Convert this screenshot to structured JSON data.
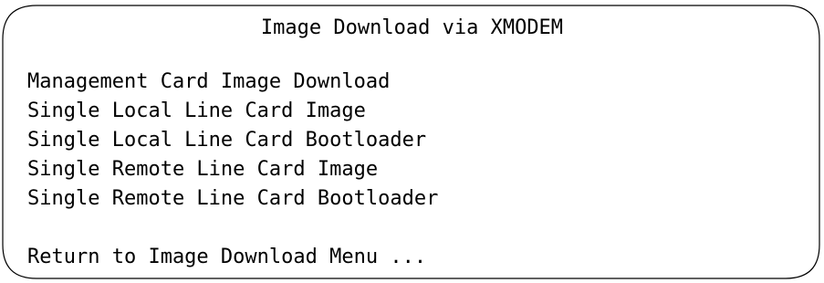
{
  "screen": {
    "title": "Image Download via XMODEM"
  },
  "menu": {
    "items": [
      {
        "label": "Management Card Image Download"
      },
      {
        "label": "Single Local Line Card Image"
      },
      {
        "label": "Single Local Line Card Bootloader"
      },
      {
        "label": "Single Remote Line Card Image"
      },
      {
        "label": "Single Remote Line Card Bootloader"
      }
    ],
    "return_label": "Return to Image Download Menu ..."
  },
  "colors": {
    "background": "#ffffff",
    "text": "#000000",
    "border": "#000000"
  }
}
